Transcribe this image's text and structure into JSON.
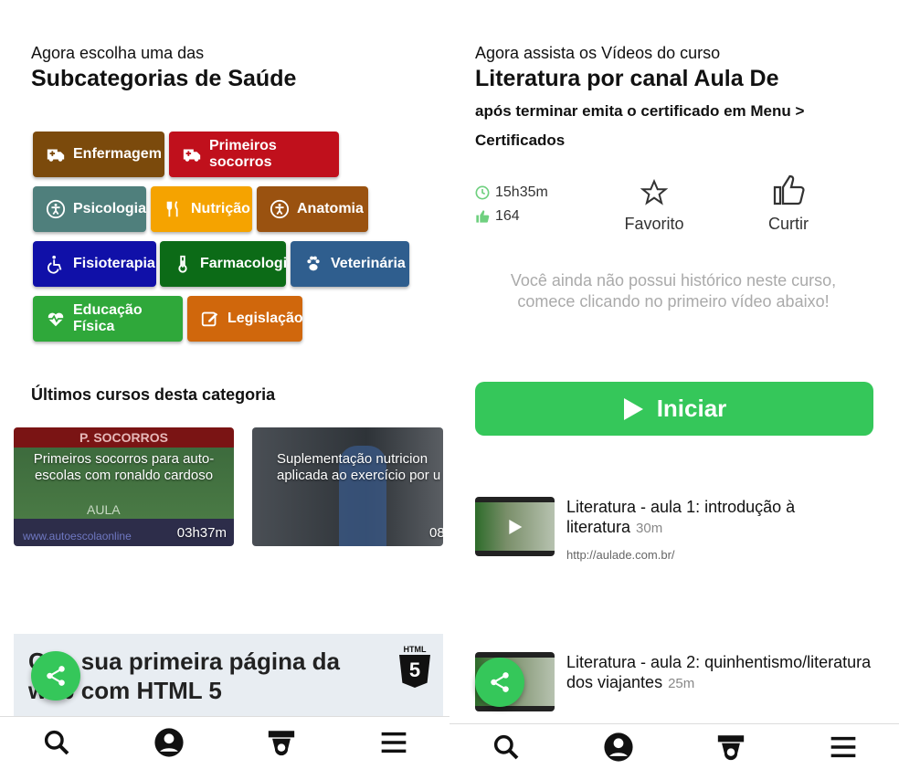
{
  "left": {
    "intro": "Agora escolha uma das",
    "title": "Subcategorias de Saúde",
    "categories": [
      {
        "label": "Enfermagem",
        "color": "#7b4a0c",
        "icon": "ambulance-icon"
      },
      {
        "label": "Primeiros socorros",
        "color": "#c0101c",
        "icon": "ambulance-icon"
      },
      {
        "label": "Psicologia",
        "color": "#4f7f7c",
        "icon": "accessibility-icon"
      },
      {
        "label": "Nutrição",
        "color": "#f5a300",
        "icon": "utensils-icon"
      },
      {
        "label": "Anatomia",
        "color": "#9a5210",
        "icon": "accessibility-icon"
      },
      {
        "label": "Fisioterapia",
        "color": "#1010a8",
        "icon": "wheelchair-icon"
      },
      {
        "label": "Farmacologia",
        "color": "#0c6b17",
        "icon": "thermometer-icon"
      },
      {
        "label": "Veterinária",
        "color": "#2f5e8e",
        "icon": "paw-icon"
      },
      {
        "label": "Educação Física",
        "color": "#2fa83a",
        "icon": "heartbeat-icon"
      },
      {
        "label": "Legislação",
        "color": "#d0670c",
        "icon": "edit-icon"
      }
    ],
    "recent_heading": "Últimos cursos desta categoria",
    "courses": [
      {
        "title_line1": "Primeiros socorros para auto-",
        "title_line2": "escolas com ronaldo cardoso",
        "duration": "03h37m",
        "thumb_tag": "P. SOCORROS",
        "thumb_word": "AULA",
        "thumb_url": "www.autoescolaonline"
      },
      {
        "title_line1": "Suplementação nutricion",
        "title_line2": "aplicada ao exercício por u",
        "duration": "08"
      }
    ],
    "banner_text": "Crie sua primeira página da web com HTML 5",
    "banner_badge": "HTML",
    "banner_badge_num": "5"
  },
  "right": {
    "intro": "Agora assista os Vídeos do curso",
    "title": "Literatura por canal Aula De",
    "note_line1": "após terminar emita o certificado em Menu >",
    "note_line2": "Certificados",
    "duration": "15h35m",
    "likes": "164",
    "favorite_label": "Favorito",
    "like_label": "Curtir",
    "empty_message": "Você ainda não possui histórico neste curso, comece clicando no primeiro vídeo abaixo!",
    "start_label": "Iniciar",
    "lessons": [
      {
        "title": "Literatura - aula 1: introdução à literatura",
        "minutes": "30m",
        "url": "http://aulade.com.br/"
      },
      {
        "title": "Literatura - aula 2: quinhentismo/literatura dos viajantes",
        "minutes": "25m",
        "url": ""
      }
    ]
  },
  "colors": {
    "accent_green": "#35c75a",
    "text_dark": "#111111",
    "muted": "#aaaaaa"
  },
  "nav_icons": [
    "search-icon",
    "user-icon",
    "graduation-cap-icon",
    "menu-icon"
  ]
}
